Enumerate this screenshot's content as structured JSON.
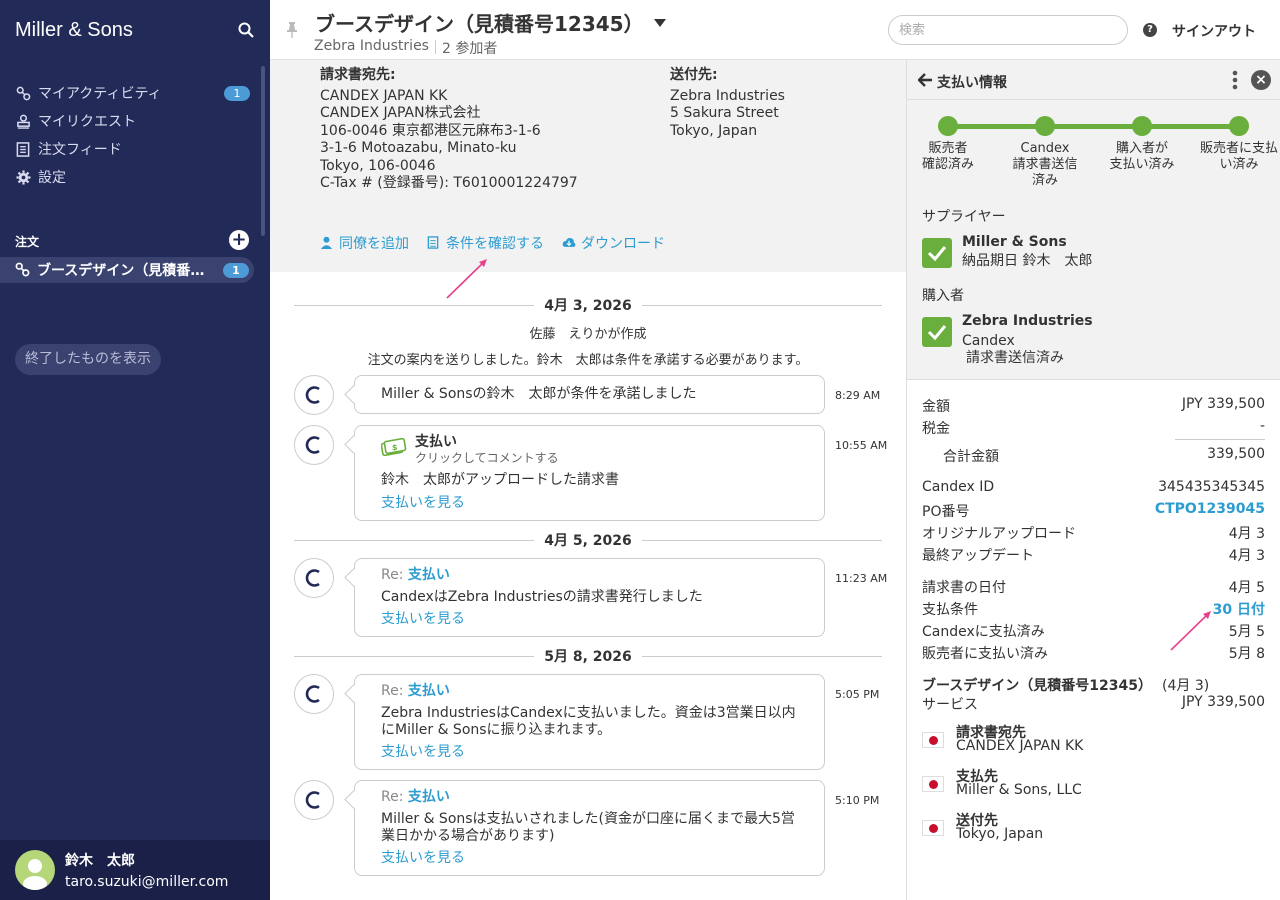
{
  "sidebar": {
    "brand": "Miller & Sons",
    "nav": [
      {
        "label": "マイアクティビティ",
        "badge": "1"
      },
      {
        "label": "マイリクエスト"
      },
      {
        "label": "注文フィード"
      },
      {
        "label": "設定"
      }
    ],
    "orders_label": "注文",
    "order_item": {
      "label": "ブースデザイン（見積番号12345）",
      "badge": "1"
    },
    "show_closed": "終了したものを表示",
    "user": {
      "name": "鈴木　太郎",
      "email": "taro.suzuki@miller.com"
    }
  },
  "header": {
    "title": "ブースデザイン（見積番号12345）",
    "company": "Zebra Industries",
    "participants": "2 参加者",
    "search_placeholder": "検索",
    "signout": "サインアウト"
  },
  "address": {
    "billing": {
      "heading": "請求書宛先:",
      "lines": [
        "CANDEX JAPAN KK",
        "CANDEX JAPAN株式会社",
        "106-0046 東京都港区元麻布3-1-6",
        "3-1-6 Motoazabu, Minato-ku",
        "Tokyo, 106-0046",
        "C-Tax # (登録番号): T6010001224797"
      ]
    },
    "shipping": {
      "heading": "送付先:",
      "lines": [
        "Zebra Industries",
        "5 Sakura Street",
        "Tokyo, Japan"
      ]
    },
    "actions": [
      "同僚を追加",
      "条件を確認する",
      "ダウンロード"
    ]
  },
  "feed": {
    "dates": [
      "4月 3, 2026",
      "4月 5, 2026",
      "5月 8, 2026"
    ],
    "created": "佐藤　えりかが作成",
    "note": "注文の案内を送りしました。鈴木　太郎は条件を承諾する必要があります。",
    "messages": [
      {
        "text": "Miller & Sonsの鈴木　太郎が条件を承諾しました",
        "time": "8:29 AM"
      },
      {
        "title": "支払い",
        "subtitle": "クリックしてコメントする",
        "text": "鈴木　太郎がアップロードした請求書",
        "link": "支払いを見る",
        "time": "10:55 AM"
      },
      {
        "re": "Re:",
        "title": "支払い",
        "text": "CandexはZebra Industriesの請求書発行しました",
        "link": "支払いを見る",
        "time": "11:23 AM"
      },
      {
        "re": "Re:",
        "title": "支払い",
        "text": "Zebra IndustriesはCandexに支払いました。資金は3営業日以内にMiller & Sonsに振り込まれます。",
        "link": "支払いを見る",
        "time": "5:05 PM"
      },
      {
        "re": "Re:",
        "title": "支払い",
        "text": "Miller & Sonsは支払いされました(資金が口座に届くまで最大5営業日かかる場合があります)",
        "link": "支払いを見る",
        "time": "5:10 PM"
      }
    ]
  },
  "payment": {
    "title": "支払い情報",
    "steps": [
      "販売者\n確認済み",
      "Candex\n請求書送信\n済み",
      "購入者が\n支払い済み",
      "販売者に支払\nい済み"
    ],
    "supplier_label": "サプライヤー",
    "supplier": {
      "name": "Miller & Sons",
      "sub": "納品期日 鈴木　太郎"
    },
    "buyer_label": "購入者",
    "buyer": {
      "name": "Zebra Industries",
      "sub1": "Candex",
      "sub2": "請求書送信済み"
    },
    "rows": [
      {
        "k": "金額",
        "v": "JPY  339,500"
      },
      {
        "k": "税金",
        "v": "-"
      },
      {
        "k": "合計金額",
        "v": "339,500"
      },
      {
        "k": "Candex ID",
        "v": "345435345345"
      },
      {
        "k": "PO番号",
        "v": "CTPO1239045"
      },
      {
        "k": "オリジナルアップロード",
        "v": "4月 3"
      },
      {
        "k": "最終アップデート",
        "v": "4月 3"
      },
      {
        "k": "請求書の日付",
        "v": "4月 5"
      },
      {
        "k": "支払条件",
        "v": "30 日付"
      },
      {
        "k": "Candexに支払済み",
        "v": "5月 5"
      },
      {
        "k": "販売者に支払い済み",
        "v": "5月 8"
      }
    ],
    "item_title": "ブースデザイン（見積番号12345）",
    "item_date": "(4月 3)",
    "item_kind": "サービス",
    "item_amount": "JPY  339,500",
    "parties": [
      {
        "h": "請求書宛先",
        "v": "CANDEX JAPAN KK"
      },
      {
        "h": "支払先",
        "v": "Miller & Sons, LLC"
      },
      {
        "h": "送付先",
        "v": "Tokyo, Japan"
      }
    ]
  },
  "colors": {
    "sidebar": "#222a57",
    "accent": "#2d9cd0",
    "success": "#6aaf3d",
    "badge": "#4c9bd6"
  }
}
